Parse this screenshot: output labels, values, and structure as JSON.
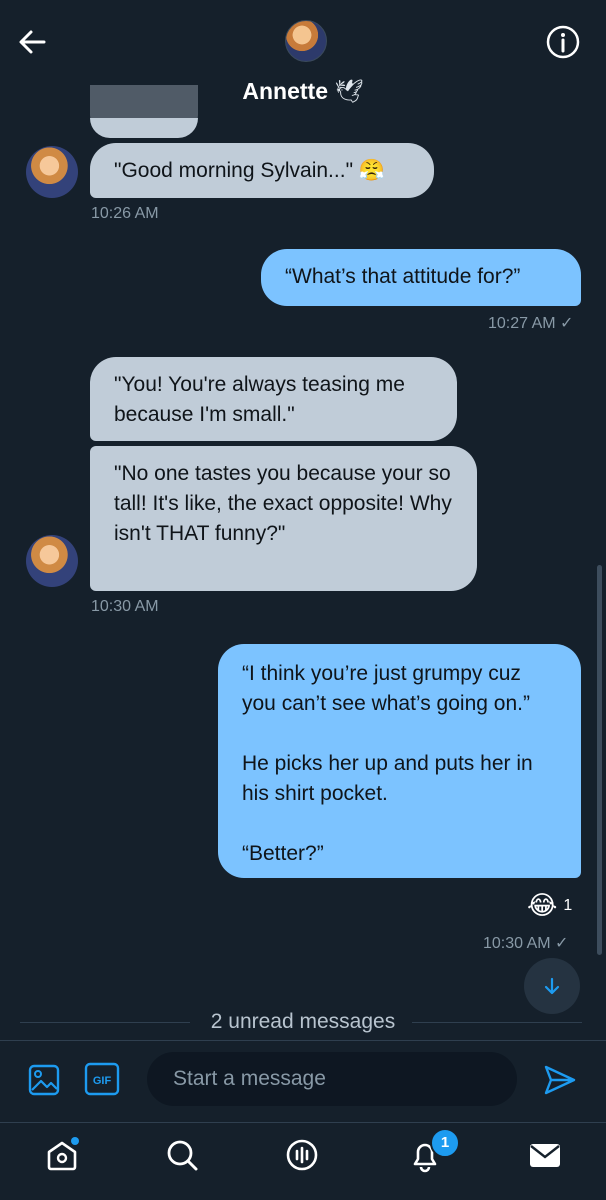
{
  "header": {
    "title": "Annette",
    "back_icon": "arrow-left-icon",
    "info_icon": "info-icon",
    "title_emoji": "dove-icon"
  },
  "messages": [
    {
      "side": "in",
      "text": "\"Good morning Sylvain...\" 😤",
      "time": "10:26 AM"
    },
    {
      "side": "out",
      "text": "“What’s that attitude for?”",
      "time": "10:27 AM ✓"
    },
    {
      "side": "in",
      "text": "\"You! You're always teasing me because I'm small.\""
    },
    {
      "side": "in",
      "text": "\"No one tastes you because your so tall! It's like, the exact opposite! Why isn't THAT funny?\"",
      "time": "10:30 AM"
    },
    {
      "side": "out",
      "text": "“I think you’re just grumpy cuz you can’t see what’s going on.”\n\nHe picks her up and puts her in his shirt pocket.\n\n“Better?”",
      "time": "10:30 AM ✓",
      "reaction": {
        "emoji": "😂",
        "count": "1"
      }
    }
  ],
  "unread_divider": "2 unread messages",
  "composer": {
    "placeholder": "Start a message"
  },
  "bottom_nav": {
    "notifications_badge": "1"
  },
  "colors": {
    "background": "#15202b",
    "incoming": "#c0ccd8",
    "outgoing": "#7cc3ff",
    "accent": "#1d9bf0"
  }
}
